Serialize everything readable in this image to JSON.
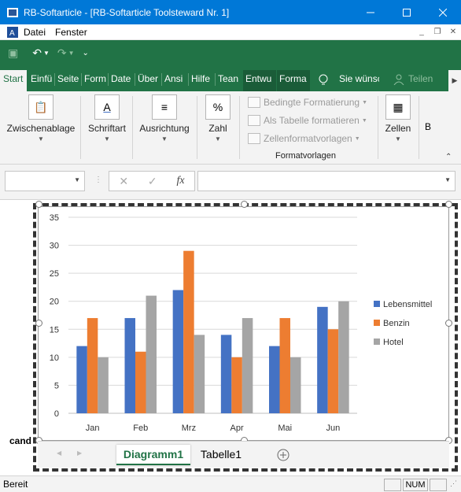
{
  "window": {
    "title": "RB-Softarticle - [RB-Softarticle Toolsteward Nr. 1]"
  },
  "menubar": {
    "items": [
      "Datei",
      "Fenster"
    ]
  },
  "ribbon_tabs": [
    "Start",
    "Einfü",
    "Seite",
    "Form",
    "Date",
    "Über",
    "Ansi",
    "Hilfe",
    "Tean",
    "Entwu",
    "Forma",
    "Sie wünsc",
    "Teilen"
  ],
  "ribbon": {
    "groups": {
      "clipboard": "Zwischenablage",
      "font": "Schriftart",
      "alignment": "Ausrichtung",
      "number": "Zahl",
      "styles": "Formatvorlagen",
      "cells": "Zellen",
      "more": "B"
    },
    "styles_items": [
      "Bedingte Formatierung",
      "Als Tabelle formatieren",
      "Zellenformatvorlagen"
    ],
    "number_icon_text": "%",
    "font_icon_text": "A"
  },
  "formula_bar": {
    "fx": "fx",
    "namebox": "",
    "formula": ""
  },
  "cell_text": "cand",
  "chart_data": {
    "type": "bar",
    "categories": [
      "Jan",
      "Feb",
      "Mrz",
      "Apr",
      "Mai",
      "Jun"
    ],
    "series": [
      {
        "name": "Lebensmittel",
        "color": "#4472c4",
        "values": [
          12,
          17,
          22,
          14,
          12,
          19
        ]
      },
      {
        "name": "Benzin",
        "color": "#ed7d31",
        "values": [
          17,
          11,
          29,
          10,
          17,
          15
        ]
      },
      {
        "name": "Hotel",
        "color": "#a5a5a5",
        "values": [
          10,
          21,
          14,
          17,
          10,
          20
        ]
      }
    ],
    "ylim": [
      0,
      35
    ],
    "yticks": [
      0,
      5,
      10,
      15,
      20,
      25,
      30,
      35
    ],
    "grid": true,
    "legend_position": "right"
  },
  "sheet_tabs": [
    "Diagramm1",
    "Tabelle1"
  ],
  "status": {
    "text": "Bereit",
    "num": "NUM"
  }
}
